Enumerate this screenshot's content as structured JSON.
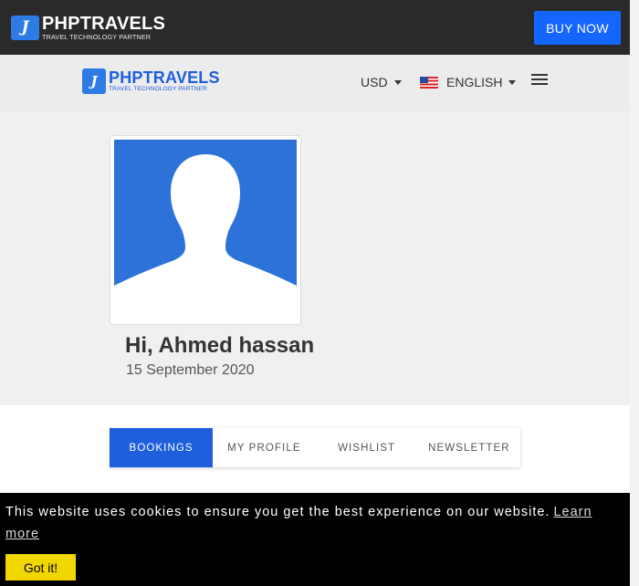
{
  "brand": {
    "name": "PHPTRAVELS",
    "tagline": "TRAVEL TECHNOLOGY PARTNER",
    "accent": "#1f5fdc"
  },
  "topbar": {
    "buy_label": "BUY NOW",
    "buy_color": "#1565ff"
  },
  "navbar": {
    "currency": "USD",
    "language": "ENGLISH",
    "language_flag": "us-flag-icon",
    "menu_icon": "hamburger-menu-icon"
  },
  "profile": {
    "greeting": "Hi, Ahmed hassan",
    "date": "15 September 2020",
    "avatar_icon": "default-user-avatar"
  },
  "tabs": [
    {
      "label": "BOOKINGS",
      "active": true
    },
    {
      "label": "MY PROFILE",
      "active": false
    },
    {
      "label": "WISHLIST",
      "active": false
    },
    {
      "label": "NEWSLETTER",
      "active": false
    }
  ],
  "cookie": {
    "message": "This website uses cookies to ensure you get the best experience on our website.",
    "learn_more": "Learn more",
    "button": "Got it!",
    "button_color": "#f1d600"
  }
}
